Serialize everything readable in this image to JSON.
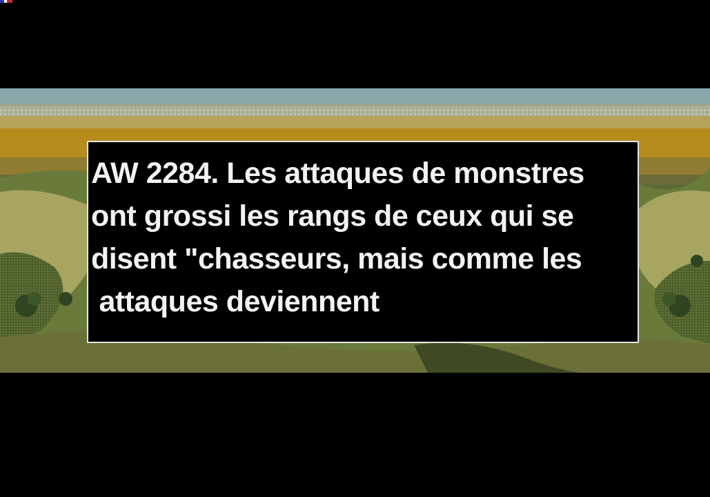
{
  "dialog": {
    "line1": "AW 2284. Les attaques de monstres",
    "line2": "ont grossi les rangs de ceux qui se",
    "line3": "disent \"chasseurs, mais comme les",
    "line4": " attaques deviennent"
  },
  "colors": {
    "sky": "#8aa7ac",
    "horizon": "#b78c1d",
    "hills": "#596a34",
    "dialog_bg": "#000000",
    "dialog_border": "#e6e6e6",
    "text": "#f2f2f2"
  }
}
